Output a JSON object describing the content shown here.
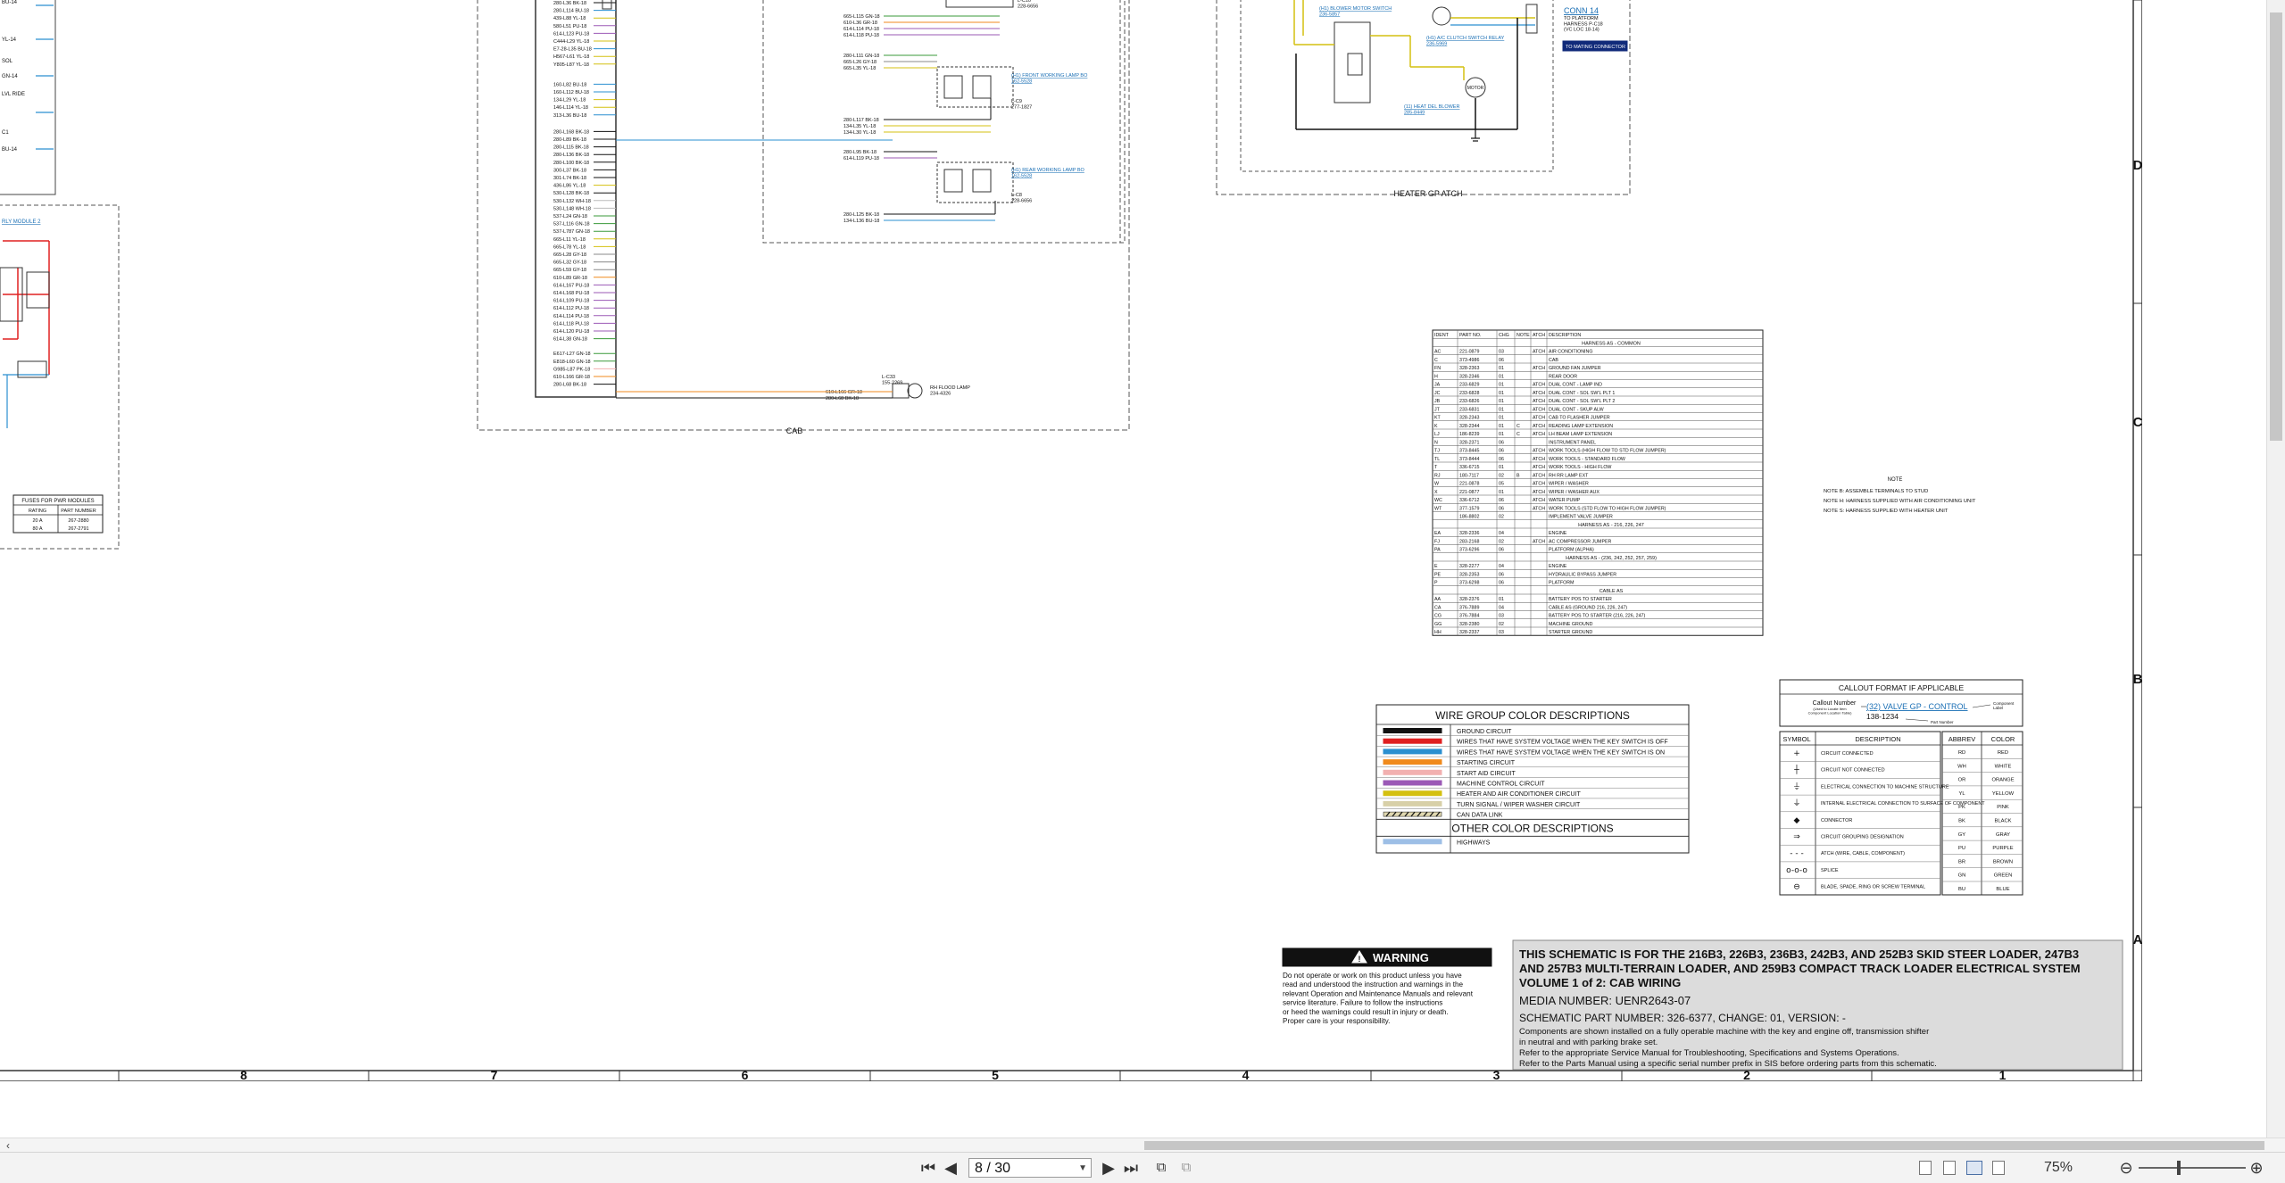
{
  "sheet": {
    "zones_bottom": [
      "8",
      "7",
      "6",
      "5",
      "4",
      "3",
      "2",
      "1"
    ],
    "zones_right": [
      "D",
      "C",
      "B",
      "A"
    ],
    "groups": {
      "cab": "CAB",
      "heater": "HEATER GP ATCH"
    },
    "left_panel": {
      "labels": [
        "BU-14",
        "YL-14",
        "SOL",
        "GN-14",
        "LVL RIDE",
        "C1",
        "BU-14",
        "RLY MODULE 2"
      ],
      "fuse_table": {
        "title": "FUSES FOR PWR MODULES",
        "headers": [
          "RATING",
          "PART NUMBER"
        ],
        "rows": [
          [
            "20 A",
            "267-2880"
          ],
          [
            "80 A",
            "267-2791"
          ]
        ]
      }
    },
    "cab_wires": [
      "280-L36 BK-18",
      "280-L114 BU-18",
      "439-L88 YL-18",
      "580-L51 PU-18",
      "614-L123 PU-18",
      "C444-L29 YL-18",
      "E7-28-L35 BU-18",
      "H567-L61 YL-18",
      "Y805-L87 YL-18",
      "160-L82 BU-18",
      "160-L112 BU-18",
      "134-L29 YL-18",
      "146-L114 YL-18",
      "313-L36 BU-18",
      "280-L168 BK-18",
      "280-L89 BK-18",
      "280-L115 BK-18",
      "280-L136 BK-18",
      "280-L100 BK-18",
      "300-L37 BK-18",
      "301-L74 BK-18",
      "436-L86 YL-18",
      "530-L128 BK-18",
      "530-L132 WH-18",
      "530-L148 WH-18",
      "537-L24 GN-18",
      "537-L116 GN-18",
      "537-L787 GN-18",
      "665-L11 YL-18",
      "665-L78 YL-18",
      "665-L28 GY-18",
      "665-L32 GY-18",
      "665-L59 GY-18",
      "610-L89 GR-18",
      "614-L167 PU-18",
      "614-L168 PU-18",
      "614-L109 PU-18",
      "614-L112 PU-18",
      "614-L114 PU-18",
      "614-L118 PU-18",
      "614-L120 PU-18",
      "614-L38 GN-18",
      "E617-L27 GN-18",
      "E818-L60 GN-18",
      "G985-L87 PK-18",
      "610-L166 GR-18",
      "280-L68 BK-18"
    ],
    "cab_components": {
      "top_right_conn": "L-C10\n228-6656",
      "rh_front_lamp": "(H1) FRONT WORKING LAMP BO\n162-5528",
      "rh_front_conn": "L-C9\n277-1827",
      "rh_rear_lamp": "(H1) REAR WORKING LAMP BO\n162-5528",
      "rh_rear_conn": "L-C8\n228-6656",
      "flood_conn": "L-C33\n155-2269",
      "flood_lamp": "RH FLOOD LAMP\n234-4326",
      "flood_wires": [
        "610-L166 GR-18",
        "280-L68 BK-18"
      ],
      "mid_wires": [
        "280-L117 BK-18",
        "134-L35 YL-18",
        "134-L30 YL-18",
        "280-L95 BK-18",
        "614-L119 PU-18",
        "280-L125 BK-18",
        "134-L136 BU-18",
        "280-L111 GN-18",
        "665-L26 GY-18",
        "665-L35 YL-18",
        "665-L115 GN-18",
        "610-L36 GR-18",
        "614-L114 PU-18",
        "614-L118 PU-18"
      ]
    },
    "heater": {
      "blower_switch": "(H1) BLOWER MOTOR SWITCH\n236-5857",
      "clutch_relay": "(H1) A/C CLUTCH SWITCH RELAY\n236-5969",
      "blower": "(11) HEAT DEL BLOWER\n285-8449",
      "motor": "MOTOR",
      "conn_title": "CONN 14",
      "conn_sub": "TO PLATFORM\nHARNESS P-C18\n(VC LOC 18-14)",
      "mating": "TO MATING CONNECTOR"
    },
    "parts_table": {
      "headers": [
        "IDENT",
        "PART NO.",
        "CHG",
        "NOTE",
        "ATCH",
        "DESCRIPTION"
      ],
      "sections": {
        "common": "HARNESS AS - COMMON",
        "s216": "HARNESS AS - 216, 226, 247",
        "s236": "HARNESS AS - (236, 242, 252, 257, 259)",
        "cable": "CABLE AS"
      },
      "rows": [
        [
          "AC",
          "221-0879",
          "03",
          "",
          "ATCH",
          "AIR CONDITIONING"
        ],
        [
          "C",
          "373-4986",
          "06",
          "",
          "",
          "CAB"
        ],
        [
          "FN",
          "328-2363",
          "01",
          "",
          "ATCH",
          "GROUND FAN JUMPER"
        ],
        [
          "H",
          "328-2346",
          "01",
          "",
          "",
          "REAR DOOR"
        ],
        [
          "JA",
          "233-6829",
          "01",
          "",
          "ATCH",
          "DUAL CONT - LAMP IND"
        ],
        [
          "JC",
          "233-6828",
          "01",
          "",
          "ATCH",
          "DUAL CONT - SOL SW'L PLT 1"
        ],
        [
          "JB",
          "233-6826",
          "01",
          "",
          "ATCH",
          "DUAL CONT - SOL SW'L PLT 2"
        ],
        [
          "JT",
          "233-6831",
          "01",
          "",
          "ATCH",
          "DUAL CONT - SKUP ALW"
        ],
        [
          "KT",
          "328-2343",
          "01",
          "",
          "ATCH",
          "CAB TO FLASHER JUMPER"
        ],
        [
          "K",
          "328-2344",
          "01",
          "C",
          "ATCH",
          "READING LAMP EXTENSION"
        ],
        [
          "LJ",
          "186-8239",
          "01",
          "C",
          "ATCH",
          "LH BEAM LAMP EXTENSION"
        ],
        [
          "N",
          "328-2371",
          "06",
          "",
          "",
          "INSTRUMENT PANEL"
        ],
        [
          "TJ",
          "373-8445",
          "06",
          "",
          "ATCH",
          "WORK TOOLS (HIGH FLOW TO STD FLOW JUMPER)"
        ],
        [
          "TL",
          "373-8444",
          "06",
          "",
          "ATCH",
          "WORK TOOLS - STANDARD FLOW"
        ],
        [
          "T",
          "336-6715",
          "01",
          "",
          "ATCH",
          "WORK TOOLS - HIGH FLOW"
        ],
        [
          "RJ",
          "180-7117",
          "02",
          "B",
          "ATCH",
          "RH RR LAMP EXT"
        ],
        [
          "W",
          "221-0878",
          "05",
          "",
          "ATCH",
          "WIPER / WASHER"
        ],
        [
          "X",
          "221-0877",
          "01",
          "",
          "ATCH",
          "WIPER / WASHER AUX"
        ],
        [
          "WC",
          "336-6712",
          "06",
          "",
          "ATCH",
          "WATER PUMP"
        ],
        [
          "WT",
          "377-1579",
          "06",
          "",
          "ATCH",
          "WORK TOOLS (STD FLOW TO HIGH FLOW JUMPER)"
        ],
        [
          "",
          "186-8802",
          "02",
          "",
          "",
          "IMPLEMENT VALVE JUMPER"
        ],
        [
          "EA",
          "328-2336",
          "04",
          "",
          "",
          "ENGINE"
        ],
        [
          "FJ",
          "283-2168",
          "02",
          "",
          "ATCH",
          "AC COMPRESSOR JUMPER"
        ],
        [
          "PA",
          "373-6296",
          "06",
          "",
          "",
          "PLATFORM (ALPHA)"
        ],
        [
          "E",
          "328-2277",
          "04",
          "",
          "",
          "ENGINE"
        ],
        [
          "PE",
          "328-2353",
          "06",
          "",
          "",
          "HYDRAULIC BYPASS JUMPER"
        ],
        [
          "P",
          "373-6298",
          "06",
          "",
          "",
          "PLATFORM"
        ],
        [
          "AA",
          "328-2376",
          "01",
          "",
          "",
          "BATTERY POS TO STARTER"
        ],
        [
          "CA",
          "376-7889",
          "04",
          "",
          "",
          "CABLE AS (GROUND 216, 226, 247)"
        ],
        [
          "CG",
          "376-7884",
          "03",
          "",
          "",
          "BATTERY POS TO STARTER (216, 226, 247)"
        ],
        [
          "GG",
          "328-2380",
          "02",
          "",
          "",
          "MACHINE GROUND"
        ],
        [
          "HH",
          "328-2337",
          "03",
          "",
          "",
          "STARTER GROUND"
        ]
      ]
    },
    "notes": {
      "title": "NOTE",
      "items": [
        "NOTE B: ASSEMBLE TERMINALS TO STUD",
        "NOTE H: HARNESS SUPPLIED WITH AIR CONDITIONING UNIT",
        "NOTE S: HARNESS SUPPLIED WITH HEATER UNIT"
      ]
    },
    "color_legend": {
      "title": "WIRE GROUP COLOR DESCRIPTIONS",
      "items": [
        {
          "color": "#111111",
          "label": "GROUND CIRCUIT"
        },
        {
          "color": "#e02020",
          "label": "WIRES THAT HAVE SYSTEM VOLTAGE WHEN THE KEY SWITCH IS OFF"
        },
        {
          "color": "#2a8fd0",
          "label": "WIRES THAT HAVE SYSTEM VOLTAGE WHEN THE KEY SWITCH IS ON"
        },
        {
          "color": "#f08a1c",
          "label": "STARTING CIRCUIT"
        },
        {
          "color": "#f2b0b0",
          "label": "START AID CIRCUIT"
        },
        {
          "color": "#9b59b6",
          "label": "MACHINE CONTROL CIRCUIT"
        },
        {
          "color": "#d4c010",
          "label": "HEATER AND AIR CONDITIONER CIRCUIT"
        },
        {
          "color": "#d8d0a8",
          "label": "TURN SIGNAL / WIPER WASHER CIRCUIT"
        },
        {
          "color": "hatch",
          "label": "CAN DATA LINK"
        }
      ],
      "other_title": "OTHER COLOR DESCRIPTIONS",
      "other_items": [
        {
          "color": "#9dbfe6",
          "label": "HIGHWAYS"
        }
      ]
    },
    "callout": {
      "title": "CALLOUT FORMAT IF APPLICABLE",
      "callout_number": "Callout Number",
      "callout_note": "(Used to Locate Item\nComponent Location Table)",
      "example": "(32) VALVE GP - CONTROL",
      "example_part": "138-1234",
      "component_label": "Component\nLabel",
      "part_number_label": "Part Number"
    },
    "symbols": {
      "headers": [
        "SYMBOL",
        "DESCRIPTION"
      ],
      "rows": [
        [
          "+",
          "CIRCUIT CONNECTED"
        ],
        [
          "┼",
          "CIRCUIT NOT CONNECTED"
        ],
        [
          "⏚",
          "ELECTRICAL CONNECTION TO MACHINE STRUCTURE"
        ],
        [
          "⏚",
          "INTERNAL ELECTRICAL CONNECTION TO SURFACE OF COMPONENT"
        ],
        [
          "◆",
          "CONNECTOR"
        ],
        [
          "⇒",
          "CIRCUIT GROUPING DESIGNATION"
        ],
        [
          "- - -",
          "ATCH (WIRE, CABLE, COMPONENT)"
        ],
        [
          "o-o-o",
          "SPLICE"
        ],
        [
          "⊖",
          "BLADE, SPADE, RING OR SCREW TERMINAL"
        ]
      ]
    },
    "abbrev": {
      "headers": [
        "ABBREV",
        "COLOR"
      ],
      "rows": [
        [
          "RD",
          "RED"
        ],
        [
          "WH",
          "WHITE"
        ],
        [
          "OR",
          "ORANGE"
        ],
        [
          "YL",
          "YELLOW"
        ],
        [
          "PK",
          "PINK"
        ],
        [
          "BK",
          "BLACK"
        ],
        [
          "GY",
          "GRAY"
        ],
        [
          "PU",
          "PURPLE"
        ],
        [
          "BR",
          "BROWN"
        ],
        [
          "GN",
          "GREEN"
        ],
        [
          "BU",
          "BLUE"
        ]
      ]
    },
    "warning": {
      "title": "WARNING",
      "text": "Do not operate or work on this product unless you have read and understood the instruction and warnings in the relevant Operation and Maintenance Manuals and relevant service literature. Failure to follow the instructions or heed the warnings could result in injury or death. Proper care is your responsibility."
    },
    "titleblock": {
      "line1": "THIS SCHEMATIC IS FOR THE 216B3, 226B3, 236B3, 242B3, AND 252B3 SKID STEER LOADER, 247B3",
      "line2": "AND 257B3 MULTI-TERRAIN LOADER, AND 259B3 COMPACT TRACK LOADER ELECTRICAL SYSTEM",
      "line3": "VOLUME 1 of 2: CAB WIRING",
      "media": "MEDIA NUMBER: UENR2643-07",
      "schematic": "SCHEMATIC PART NUMBER: 326-6377, CHANGE: 01, VERSION: -",
      "note1": "Components are shown installed on a fully operable machine with the key and engine off, transmission shifter",
      "note2": "in neutral and with parking brake set.",
      "note3": "Refer to the appropriate Service Manual for Troubleshooting, Specifications and Systems Operations.",
      "note4": "Refer to the Parts Manual using a specific serial number prefix in SIS before ordering parts from this schematic."
    }
  },
  "toolbar": {
    "first_icon": "first-page-icon",
    "prev_icon": "previous-page-icon",
    "page_value": "8 / 30",
    "next_icon": "next-page-icon",
    "last_icon": "last-page-icon",
    "zoom_value": "75%",
    "zoom_out_icon": "zoom-out-icon",
    "zoom_in_icon": "zoom-in-icon"
  }
}
